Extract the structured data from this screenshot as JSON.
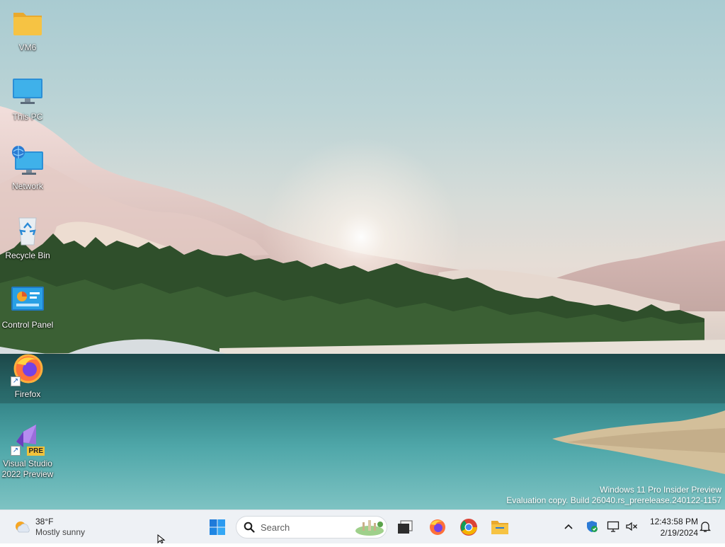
{
  "desktop": {
    "icons": [
      {
        "label": "VM6",
        "icon": "folder-icon"
      },
      {
        "label": "This PC",
        "icon": "monitor-icon"
      },
      {
        "label": "Network",
        "icon": "network-icon"
      },
      {
        "label": "Recycle Bin",
        "icon": "recycle-bin-icon"
      },
      {
        "label": "Control Panel",
        "icon": "control-panel-icon"
      },
      {
        "label": "Firefox",
        "icon": "firefox-icon"
      },
      {
        "label": "Visual Studio 2022 Preview",
        "icon": "visual-studio-icon",
        "badge": "PRE"
      }
    ],
    "watermark": {
      "line1": "Windows 11 Pro Insider Preview",
      "line2": "Evaluation copy. Build 26040.rs_prerelease.240122-1157"
    }
  },
  "taskbar": {
    "weather": {
      "temp": "38°F",
      "condition": "Mostly sunny",
      "icon": "partly-sunny-icon"
    },
    "search": {
      "placeholder": "Search"
    },
    "pinned": [
      "start-icon",
      "task-view-icon",
      "firefox-icon",
      "chrome-icon",
      "file-explorer-icon"
    ],
    "tray": [
      "chevron-up-icon",
      "defender-shield-icon",
      "display-icon",
      "speaker-muted-icon"
    ],
    "clock": {
      "time": "12:43:58 PM",
      "date": "2/19/2024"
    },
    "colors": {
      "taskbar_bg": "#eef1f5",
      "start_blue": "#1f7ad9",
      "folder_yellow": "#f6c343"
    }
  }
}
